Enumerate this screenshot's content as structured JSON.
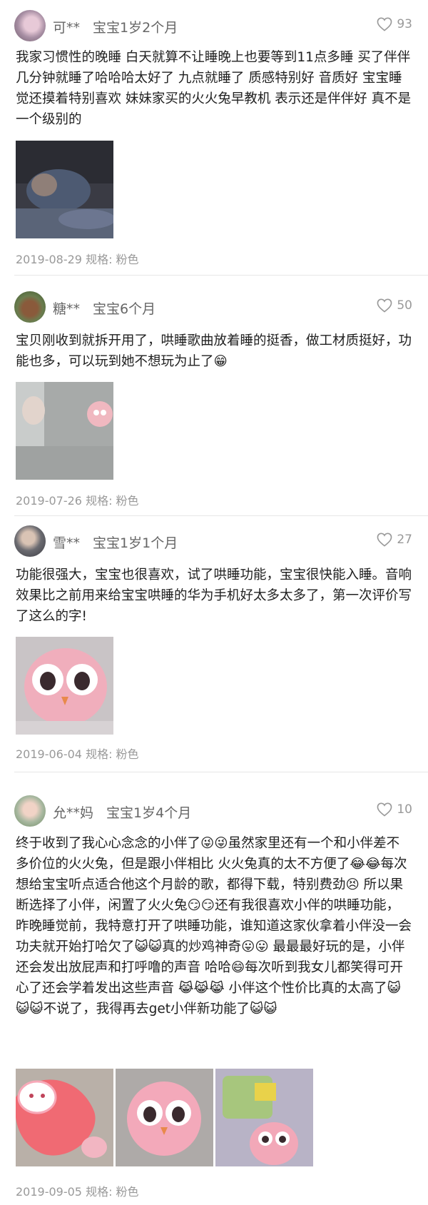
{
  "reviews": [
    {
      "user": "可**",
      "baby": "宝宝1岁2个月",
      "likes": "93",
      "text": "我家习惯性的晚睡 白天就算不让睡晚上也要等到11点多睡 买了伴伴几分钟就睡了哈哈哈太好了 九点就睡了 质感特别好 音质好 宝宝睡觉还摸着特别喜欢 妹妹家买的火火兔早教机 表示还是伴伴好 真不是一个级别的",
      "date": "2019-08-29",
      "spec": "规格: 粉色"
    },
    {
      "user": "糖**",
      "baby": "宝宝6个月",
      "likes": "50",
      "text": "宝贝刚收到就拆开用了，哄睡歌曲放着睡的挺香，做工材质挺好，功能也多，可以玩到她不想玩为止了😁",
      "date": "2019-07-26",
      "spec": "规格: 粉色"
    },
    {
      "user": "雪**",
      "baby": "宝宝1岁1个月",
      "likes": "27",
      "text": "功能很强大，宝宝也很喜欢，试了哄睡功能，宝宝很快能入睡。音响效果比之前用来给宝宝哄睡的华为手机好太多太多了，第一次评价写了这么的字!",
      "date": "2019-06-04",
      "spec": "规格: 粉色"
    },
    {
      "user": "允**妈",
      "baby": "宝宝1岁4个月",
      "likes": "10",
      "text": "终于收到了我心心念念的小伴了😜😜虽然家里还有一个和小伴差不多价位的火火兔，但是跟小伴相比 火火兔真的太不方便了😂😂每次想给宝宝听点适合他这个月龄的歌，都得下载，特别费劲😣 所以果断选择了小伴，闲置了火火兔😏😏还有我很喜欢小伴的哄睡功能，昨晚睡觉前，我特意打开了哄睡功能，谁知道这家伙拿着小伴没一会功夫就开始打哈欠了😺😺真的炒鸡神奇😛😛 最最最好玩的是，小伴还会发出放屁声和打呼噜的声音 哈哈😄每次听到我女儿都笑得可开心了还会学着发出这些声音 😹😹😹 小伴这个性价比真的太高了😺😺😺不说了，我得再去get小伴新功能了😺😺",
      "date": "2019-09-05",
      "spec": "规格: 粉色"
    }
  ]
}
